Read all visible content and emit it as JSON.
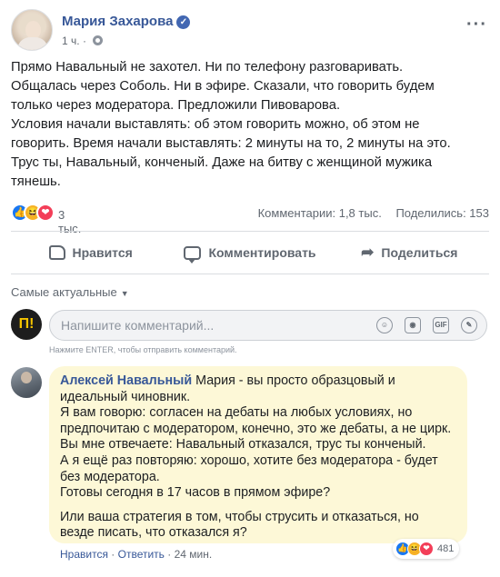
{
  "post": {
    "author": "Мария Захарова",
    "verified_glyph": "✓",
    "time": "1 ч.",
    "time_separator": "·",
    "more_glyph": "···",
    "lines": [
      "Прямо Навальный не захотел. Ни по телефону разговаривать.",
      "Общалась через Соболь. Ни в эфире. Сказали, что говорить будем",
      "только через модератора. Предложили Пивоварова.",
      "Условия начали выставлять: об этом говорить можно, об этом не",
      "говорить. Время начали выставлять: 2 минуты на то, 2 минуты на это.",
      "Трус ты, Навальный, конченый. Даже на битву с женщиной мужика",
      "тянешь."
    ]
  },
  "stats": {
    "reactions": [
      "like",
      "haha",
      "love"
    ],
    "reaction_glyphs": {
      "like": "👍",
      "haha": "😆",
      "love": "❤"
    },
    "reaction_count": "3 тыс.",
    "comments": "Комментарии: 1,8 тыс.",
    "shares": "Поделились: 153"
  },
  "actions": {
    "like": "Нравится",
    "comment": "Комментировать",
    "share": "Поделиться",
    "share_glyph": "➦"
  },
  "sort": {
    "label": "Самые актуальные",
    "caret": "▼"
  },
  "composer": {
    "avatar_letter": "П!",
    "placeholder": "Напишите комментарий...",
    "icons": [
      "emoji-icon",
      "camera-icon",
      "gif-icon",
      "sticker-icon"
    ],
    "icon_glyphs": [
      "☺",
      "◉",
      "GIF",
      "✎"
    ],
    "hint": "Нажмите ENTER, чтобы отправить комментарий."
  },
  "reply": {
    "author": "Алексей Навальный",
    "lines": [
      "Мария - вы просто образцовый и",
      "идеальный чиновник.",
      "Я вам говорю: согласен на дебаты на любых условиях, но",
      "предпочитаю с модератором, конечно, это же дебаты, а не цирк.",
      "Вы мне отвечаете: Навальный отказался, трус ты конченый.",
      "А я ещё раз повторяю: хорошо, хотите без модератора - будет",
      "без модератора.",
      "Готовы сегодня в 17 часов в прямом эфире?"
    ],
    "lines2": [
      "Или ваша стратегия в том, чтобы струсить и отказаться, но",
      "везде писать, что отказался я?"
    ],
    "like": "Нравится",
    "reply": "Ответить",
    "time": "24 мин.",
    "sep": "·",
    "reaction_count": "481"
  }
}
